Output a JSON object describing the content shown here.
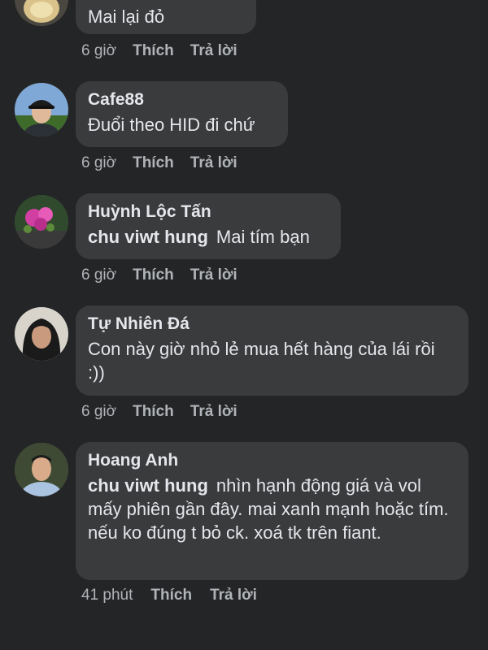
{
  "comments": [
    {
      "name": "",
      "mention": "",
      "text": "Mai lại đỏ",
      "time": "6 giờ",
      "like": "Thích",
      "reply": "Trả lời",
      "avatar_icon": "partial-avatar"
    },
    {
      "name": "Cafe88",
      "mention": "",
      "text": "Đuổi theo HID đi chứ",
      "time": "6 giờ",
      "like": "Thích",
      "reply": "Trả lời",
      "avatar_icon": "man-with-cap-avatar"
    },
    {
      "name": "Huỳnh Lộc Tấn",
      "mention": "chu viwt hung",
      "text": "Mai tím bạn",
      "time": "6 giờ",
      "like": "Thích",
      "reply": "Trả lời",
      "avatar_icon": "flower-avatar"
    },
    {
      "name": "Tự Nhiên Đá",
      "mention": "",
      "text": "Con này giờ nhỏ lẻ mua hết hàng của lái rồi :))",
      "time": "6 giờ",
      "like": "Thích",
      "reply": "Trả lời",
      "avatar_icon": "woman-avatar"
    },
    {
      "name": "Hoang Anh",
      "mention": "chu viwt hung",
      "text": "nhìn hạnh động giá và vol mấy phiên gần đây. mai xanh mạnh hoặc tím. nếu ko đúng t bỏ ck. xoá tk trên fiant.",
      "time": "41 phút",
      "like": "Thích",
      "reply": "Trả lời",
      "avatar_icon": "man-in-shirt-avatar"
    }
  ],
  "colors": {
    "background": "#242526",
    "bubble": "#3a3b3c",
    "text": "#e4e6eb",
    "meta": "#b0b3b8"
  }
}
